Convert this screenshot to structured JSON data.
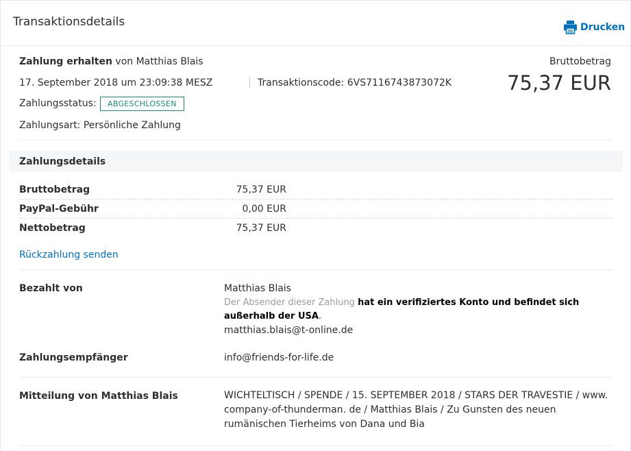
{
  "header": {
    "title": "Transaktionsdetails",
    "print_label": "Drucken"
  },
  "summary": {
    "payment_received": "Zahlung erhalten",
    "from_label": "von Matthias Blais",
    "datetime": "17. September 2018 um 23:09:38 MESZ",
    "transaction_code": "Transaktionscode: 6VS7116743873072K",
    "status_label": "Zahlungsstatus:",
    "status_value": "ABGESCHLOSSEN",
    "payment_type": "Zahlungsart: Persönliche Zahlung",
    "gross_label": "Bruttobetrag",
    "gross_amount": "75,37 EUR"
  },
  "payment_details": {
    "section_title": "Zahlungsdetails",
    "rows": [
      {
        "label": "Bruttobetrag",
        "value": "75,37 EUR"
      },
      {
        "label": "PayPal-Gebühr",
        "value": "0,00 EUR"
      },
      {
        "label": "Nettobetrag",
        "value": "75,37 EUR"
      }
    ],
    "refund_link": "Rückzahlung senden"
  },
  "paid_by": {
    "label": "Bezahlt von",
    "name": "Matthias Blais",
    "note_prefix": "Der Absender dieser Zahlung",
    "note_bold": "hat ein verifiziertes Konto und befindet sich außerhalb der USA",
    "note_suffix": ".",
    "email": "matthias.blais@t-online.de"
  },
  "recipient": {
    "label": "Zahlungsempfänger",
    "email": "info@friends-for-life.de"
  },
  "message": {
    "label": "Mitteilung von Matthias Blais",
    "text": "WICHTELTISCH / SPENDE / 15. SEPTEMBER 2018 / STARS DER TRAVESTIE / www. company-of-thunderman. de / Matthias Blais / Zu Gunsten des neuen rumänischen Tierheims von Dana und Bia"
  },
  "colors": {
    "link": "#0070ba",
    "status": "#1a8f6b",
    "section_bg": "#f5f6f7"
  },
  "icons": {
    "print": "printer-icon"
  }
}
